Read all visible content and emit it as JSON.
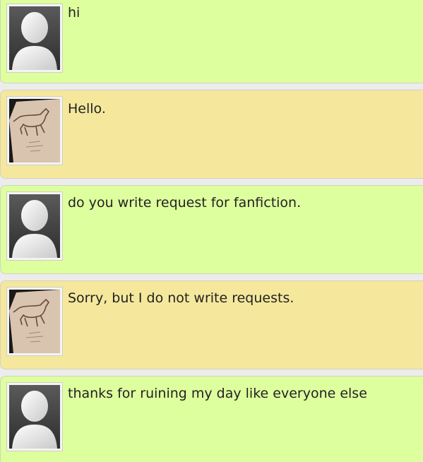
{
  "messages": [
    {
      "author": "user",
      "text": "hi",
      "avatar": "default-silhouette-icon",
      "color": "#deff9e"
    },
    {
      "author": "writer",
      "text": "Hello.",
      "avatar": "horse-sketch-avatar",
      "color": "#f5e89c"
    },
    {
      "author": "user",
      "text": "do you write request for fanfiction.",
      "avatar": "default-silhouette-icon",
      "color": "#deff9e"
    },
    {
      "author": "writer",
      "text": "Sorry, but I do not write requests.",
      "avatar": "horse-sketch-avatar",
      "color": "#f5e89c"
    },
    {
      "author": "user",
      "text": "thanks for ruining my day like everyone else",
      "avatar": "default-silhouette-icon",
      "color": "#deff9e"
    }
  ]
}
